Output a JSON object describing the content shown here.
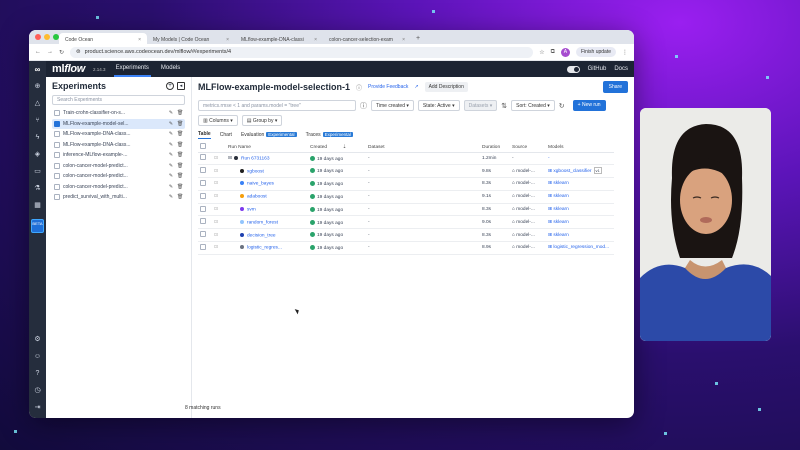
{
  "browser": {
    "tabs": [
      {
        "label": "Code Ocean",
        "active": true
      },
      {
        "label": "My Models | Code Ocean",
        "active": false
      },
      {
        "label": "MLflow-example-DNA-classi",
        "active": false
      },
      {
        "label": "colon-cancer-selection-exam",
        "active": false
      }
    ],
    "new_tab": "+",
    "url": "product.science.aws.codeocean.dev/mlflow/#/experiments/4",
    "finish_update": "Finish update",
    "avatar_letter": "A"
  },
  "app": {
    "brand": "mlflow",
    "brand_ml": "ml",
    "brand_flow": "flow",
    "version": "2.14.3",
    "nav": [
      {
        "label": "Experiments",
        "active": true
      },
      {
        "label": "Models",
        "active": false
      }
    ],
    "github": "GitHub",
    "docs": "Docs",
    "rail_beta": "BETA"
  },
  "sidebar": {
    "title": "Experiments",
    "search_placeholder": "Search Experiments",
    "items": [
      {
        "name": "Train-crohn-classifier-on-s...",
        "checked": false,
        "selected": false
      },
      {
        "name": "MLFlow-example-model-sel...",
        "checked": true,
        "selected": true
      },
      {
        "name": "MLFlow-example-DNA-class...",
        "checked": false,
        "selected": false
      },
      {
        "name": "MLFlow-example-DNA-class...",
        "checked": false,
        "selected": false
      },
      {
        "name": "inference-MLflow-example-...",
        "checked": false,
        "selected": false
      },
      {
        "name": "colon-cancer-model-predict...",
        "checked": false,
        "selected": false
      },
      {
        "name": "colon-cancer-model-predict...",
        "checked": false,
        "selected": false
      },
      {
        "name": "colon-cancer-model-predict...",
        "checked": false,
        "selected": false
      },
      {
        "name": "predict_survival_with_multi...",
        "checked": false,
        "selected": false
      }
    ]
  },
  "content": {
    "title": "MLFlow-example-model-selection-1",
    "provide_feedback": "Provide Feedback",
    "add_description": "Add Description",
    "share": "Share",
    "search_placeholder": "metrics.rmse < 1 and params.model = \"tree\"",
    "time_created": "Time created",
    "state": "State: Active",
    "datasets": "Datasets",
    "sort": "Sort: Created",
    "new_run": "+ New run",
    "columns": "Columns",
    "group_by": "Group by",
    "view_tabs": {
      "table": "Table",
      "chart": "Chart",
      "evaluation": "Evaluation",
      "evaluation_badge": "Experimental",
      "traces": "Traces",
      "traces_badge": "Experimental"
    },
    "headers": {
      "run_name": "Run Name",
      "created": "Created",
      "dataset": "Dataset",
      "duration": "Duration",
      "source": "Source",
      "models": "Models"
    },
    "runs": [
      {
        "name": "Run 6731163",
        "color": "#2a2f3a",
        "created": "19 days ago",
        "dataset": "-",
        "duration": "1.2min",
        "source": "-",
        "models": "-",
        "parent": true
      },
      {
        "name": "xgboost",
        "color": "#1f1f1f",
        "created": "19 days ago",
        "dataset": "-",
        "duration": "9.8s",
        "source": "model-...",
        "models": "xgboost_classifier",
        "models_extra": "v1"
      },
      {
        "name": "naive_bayes",
        "color": "#3b82f6",
        "created": "19 days ago",
        "dataset": "-",
        "duration": "8.3s",
        "source": "model-...",
        "models": "sklearn"
      },
      {
        "name": "adaboost",
        "color": "#f59e0b",
        "created": "19 days ago",
        "dataset": "-",
        "duration": "9.1s",
        "source": "model-...",
        "models": "sklearn"
      },
      {
        "name": "svm",
        "color": "#7c3aed",
        "created": "19 days ago",
        "dataset": "-",
        "duration": "8.3s",
        "source": "model-...",
        "models": "sklearn"
      },
      {
        "name": "random_forest",
        "color": "#93c5fd",
        "created": "19 days ago",
        "dataset": "-",
        "duration": "9.0s",
        "source": "model-...",
        "models": "sklearn"
      },
      {
        "name": "decision_tree",
        "color": "#1e40af",
        "created": "19 days ago",
        "dataset": "-",
        "duration": "8.3s",
        "source": "model-...",
        "models": "sklearn"
      },
      {
        "name": "logistic_regres...",
        "color": "#6b7280",
        "created": "19 days ago",
        "dataset": "-",
        "duration": "8.9s",
        "source": "model-...",
        "models": "logistic_regression_mod..."
      }
    ],
    "matching": "8 matching runs"
  }
}
